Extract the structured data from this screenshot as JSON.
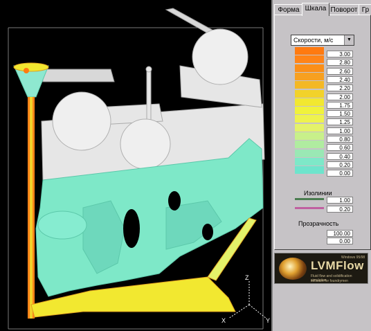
{
  "tabs": [
    "Форма",
    "Шкала",
    "Поворот",
    "Гр"
  ],
  "active_tab": "Шкала",
  "scale_select": {
    "value": "Скорости, м/с"
  },
  "scale_entries": [
    {
      "value": "3.00",
      "color": "#ff7a10"
    },
    {
      "value": "2.80",
      "color": "#ff8418"
    },
    {
      "value": "2.60",
      "color": "#fb8f18"
    },
    {
      "value": "2.40",
      "color": "#f7a020"
    },
    {
      "value": "2.20",
      "color": "#f4b824"
    },
    {
      "value": "2.00",
      "color": "#f2d22a"
    },
    {
      "value": "1.75",
      "color": "#f2e830"
    },
    {
      "value": "1.50",
      "color": "#f0f23c"
    },
    {
      "value": "1.25",
      "color": "#eef24e"
    },
    {
      "value": "1.00",
      "color": "#e4f26a"
    },
    {
      "value": "0.80",
      "color": "#c8f08a"
    },
    {
      "value": "0.60",
      "color": "#b0eca0"
    },
    {
      "value": "0.40",
      "color": "#9ae8b4"
    },
    {
      "value": "0.20",
      "color": "#7ee8c8"
    },
    {
      "value": "0.00",
      "color": "#6ee4cc"
    }
  ],
  "isolines": {
    "label": "Изолинии",
    "items": [
      {
        "value": "1.00",
        "color": "#4a7c50"
      },
      {
        "value": "0.20",
        "color": "#c060a0"
      }
    ]
  },
  "transparency": {
    "label": "Прозрачность",
    "values": [
      "100.00",
      "0.00"
    ]
  },
  "logo": {
    "title": "LVMFlow",
    "line1": "Windows 95/98",
    "line2": "Fluid flow and solidification simulation",
    "line3": "software for foundrymen"
  },
  "axes": {
    "x": "X",
    "y": "Y",
    "z": "Z"
  }
}
